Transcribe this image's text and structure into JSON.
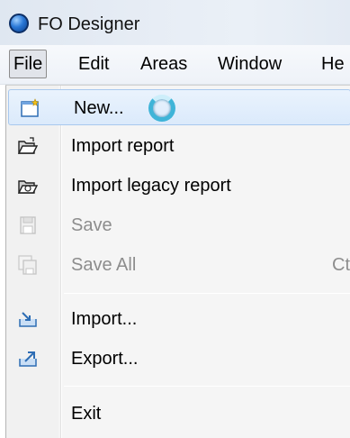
{
  "window": {
    "title": "FO Designer"
  },
  "menubar": {
    "items": [
      {
        "label": "File",
        "active": true
      },
      {
        "label": "Edit"
      },
      {
        "label": "Areas"
      },
      {
        "label": "Window"
      },
      {
        "label": "He"
      }
    ]
  },
  "file_menu": {
    "items": [
      {
        "label": "New...",
        "icon": "new-document-icon",
        "highlighted": true,
        "busy": true
      },
      {
        "label": "Import report",
        "icon": "open-folder-icon"
      },
      {
        "label": "Import legacy report",
        "icon": "open-legacy-folder-icon"
      },
      {
        "label": "Save",
        "icon": "save-disk-icon",
        "disabled": true
      },
      {
        "label": "Save All",
        "icon": "save-all-icon",
        "disabled": true,
        "shortcut": "Ct"
      },
      {
        "label": "Import...",
        "icon": "import-tray-icon"
      },
      {
        "label": "Export...",
        "icon": "export-tray-icon"
      },
      {
        "label": "Exit"
      }
    ]
  },
  "colors": {
    "highlight_bg": "#dbeafb",
    "highlight_border": "#a8c8ee",
    "disabled_text": "#8d8d8d",
    "icon_blue": "#2e6db4",
    "spinner": "#3fb4d8"
  }
}
